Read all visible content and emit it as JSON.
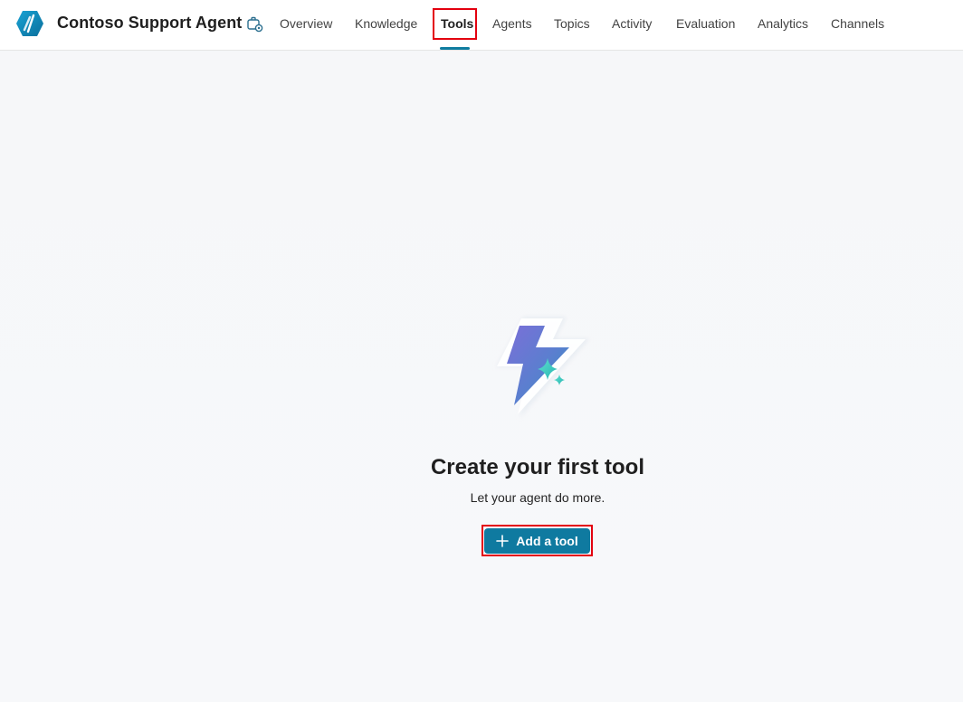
{
  "app": {
    "title": "Contoso Support Agent",
    "logo_icon": "agent-logo-icon",
    "title_icon": "briefcase-settings-icon"
  },
  "nav": {
    "tabs": [
      {
        "label": "Overview"
      },
      {
        "label": "Knowledge"
      },
      {
        "label": "Tools",
        "active": true
      },
      {
        "label": "Agents"
      },
      {
        "label": "Topics"
      },
      {
        "label": "Activity"
      },
      {
        "label": "Evaluation"
      },
      {
        "label": "Analytics"
      },
      {
        "label": "Channels"
      }
    ]
  },
  "empty_state": {
    "illustration": "lightning-sparkle-icon",
    "title": "Create your first tool",
    "subtitle": "Let your agent do more.",
    "button_label": "Add a tool",
    "button_icon": "plus-icon"
  },
  "colors": {
    "accent": "#0f7aa0",
    "highlight": "#e3000f",
    "background": "#f6f7f9"
  }
}
